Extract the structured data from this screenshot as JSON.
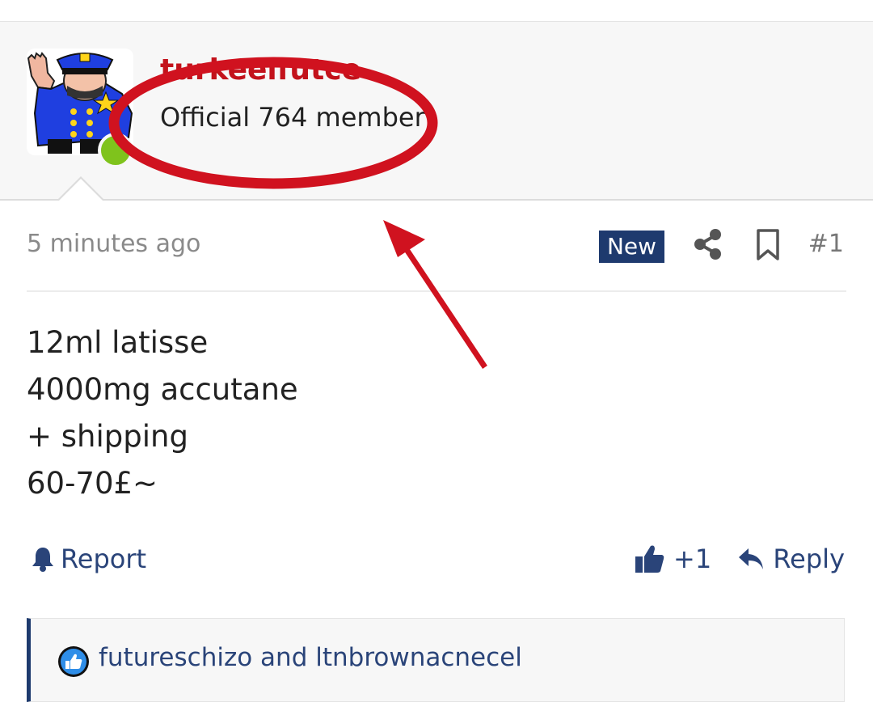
{
  "post": {
    "author": {
      "username": "turkeelfutcel",
      "title": "Official 764 member",
      "online": true,
      "avatar_icon": "police-officer-avatar"
    },
    "timestamp": "5 minutes ago",
    "badge": "New",
    "post_number": "#1",
    "body_lines": [
      "12ml latisse",
      "4000mg accutane",
      "+ shipping",
      "60-70£~"
    ],
    "actions": {
      "report_label": "Report",
      "like_count": "+1",
      "reply_label": "Reply"
    },
    "reactions": {
      "text": "futureschizo and ltnbrownacnecel",
      "icon": "like-reaction-icon"
    }
  },
  "colors": {
    "accent": "#1e3a6e",
    "link": "#2a4479",
    "username": "#c3121b",
    "annotation": "#d0121f",
    "online": "#7fc31c"
  }
}
